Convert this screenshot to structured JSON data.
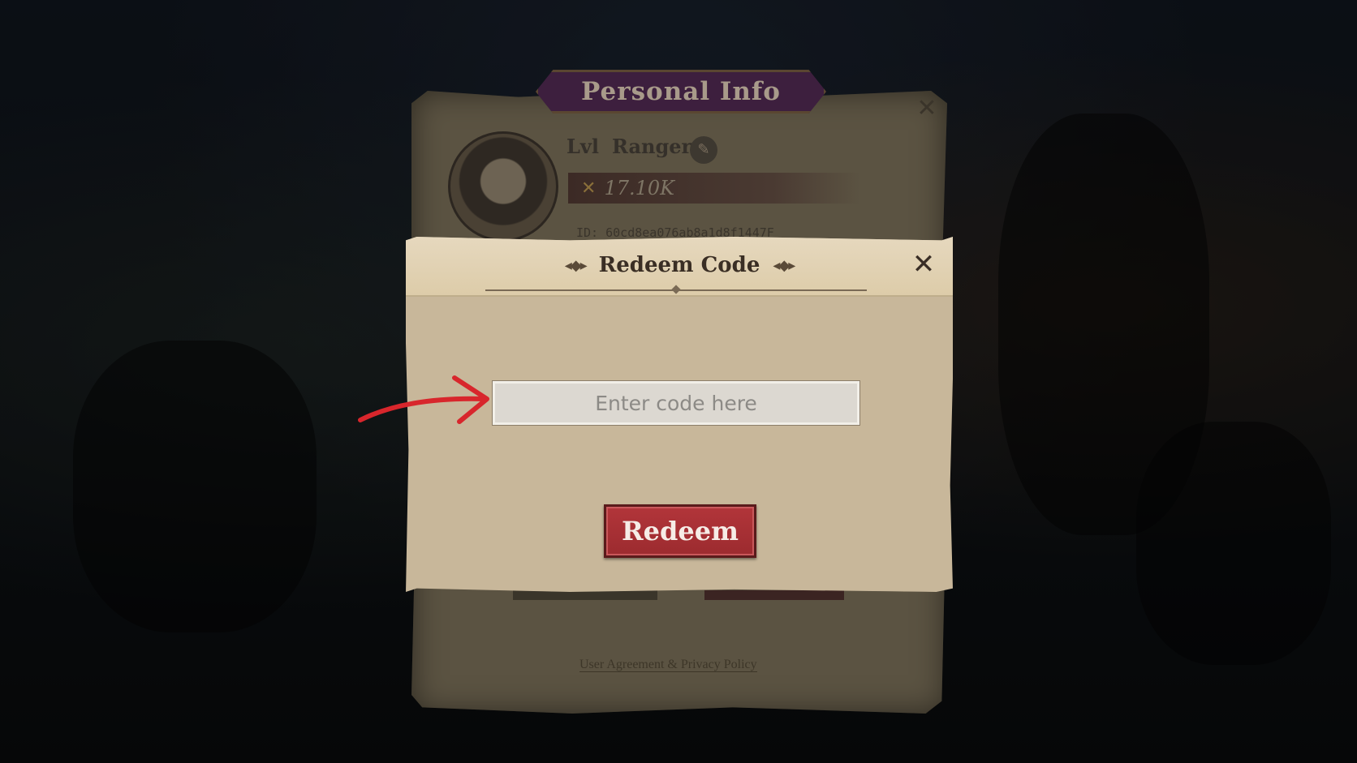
{
  "background_panel": {
    "title": "Personal Info",
    "level_label": "Lvl",
    "class_name": "Ranger",
    "power_value": "17.10K",
    "player_id": "ID: 60cd8ea076ab8a1d8f1447F",
    "footer_link": "User Agreement & Privacy Policy"
  },
  "dialog": {
    "title": "Redeem Code",
    "input_placeholder": "Enter code here",
    "input_value": "",
    "redeem_label": "Redeem",
    "close_symbol": "✕"
  },
  "icons": {
    "close": "close-icon",
    "edit": "pencil-icon",
    "power": "crossed-swords-icon",
    "ornament": "filigree-ornament-icon",
    "arrow": "red-arrow-annotation"
  },
  "colors": {
    "redeem_button": "#a52f33",
    "dialog_paper": "#c8b79a",
    "header_paper": "#e6d8be",
    "title_banner": "#3d1f3e",
    "arrow": "#d8262c"
  }
}
